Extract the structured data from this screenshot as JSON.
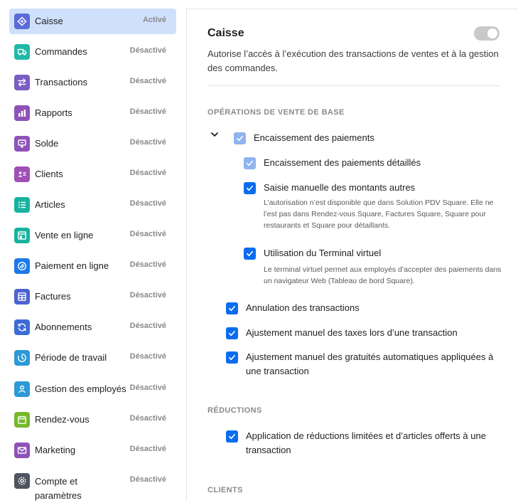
{
  "sidebar": {
    "items": [
      {
        "label": "Caisse",
        "status": "Activé",
        "icon": "register-icon",
        "color": "#5b6bd8"
      },
      {
        "label": "Commandes",
        "status": "Désactivé",
        "icon": "truck-icon",
        "color": "#20b8a6"
      },
      {
        "label": "Transactions",
        "status": "Désactivé",
        "icon": "swap-arrows-icon",
        "color": "#7b5cc4"
      },
      {
        "label": "Rapports",
        "status": "Désactivé",
        "icon": "bar-chart-icon",
        "color": "#8e52b8"
      },
      {
        "label": "Solde",
        "status": "Désactivé",
        "icon": "balance-icon",
        "color": "#8e52b8"
      },
      {
        "label": "Clients",
        "status": "Désactivé",
        "icon": "customer-card-icon",
        "color": "#a04fb6"
      },
      {
        "label": "Articles",
        "status": "Désactivé",
        "icon": "list-icon",
        "color": "#18b3a0"
      },
      {
        "label": "Vente en ligne",
        "status": "Désactivé",
        "icon": "storefront-icon",
        "color": "#18b3a0"
      },
      {
        "label": "Paiement en ligne",
        "status": "Désactivé",
        "icon": "link-icon",
        "color": "#1d7be8"
      },
      {
        "label": "Factures",
        "status": "Désactivé",
        "icon": "invoice-icon",
        "color": "#4b62d0"
      },
      {
        "label": "Abonnements",
        "status": "Désactivé",
        "icon": "refresh-icon",
        "color": "#3d6bd6"
      },
      {
        "label": "Période de travail",
        "status": "Désactivé",
        "icon": "clock-icon",
        "color": "#2b9ad6"
      },
      {
        "label": "Gestion des employés",
        "status": "Désactivé",
        "icon": "employee-icon",
        "color": "#2b9ad6"
      },
      {
        "label": "Rendez-vous",
        "status": "Désactivé",
        "icon": "calendar-icon",
        "color": "#76b82a"
      },
      {
        "label": "Marketing",
        "status": "Désactivé",
        "icon": "envelope-icon",
        "color": "#8e52b8"
      },
      {
        "label": "Compte et paramètres",
        "status": "Désactivé",
        "icon": "gear-icon",
        "color": "#4f5560"
      }
    ]
  },
  "main": {
    "title": "Caisse",
    "toggle_state": "off",
    "description": "Autorise l’accès à l’exécution des transactions de ventes et à la gestion des commandes.",
    "sections": {
      "base": "OPÉRATIONS DE VENTE DE BASE",
      "reductions": "RÉDUCTIONS",
      "clients": "CLIENTS"
    },
    "options": {
      "encaissement": "Encaissement des paiements",
      "encaissement_detail": "Encaissement des paiements détaillés",
      "saisie": "Saisie manuelle des montants autres",
      "saisie_note": "L’autorisation n’est disponible que dans Solution PDV Square. Elle ne l’est pas dans Rendez-vous Square, Factures Square, Square pour restaurants et Square pour détaillants.",
      "terminal": "Utilisation du Terminal virtuel",
      "terminal_note": "Le terminal virtuel permet aux employés d’accepter des paiements dans un navigateur Web (Tableau de bord Square).",
      "annulation": "Annulation des transactions",
      "taxes": "Ajustement manuel des taxes lors d’une transaction",
      "gratuites": "Ajustement manuel des gratuités automatiques appliquées à une transaction",
      "reductions_opt": "Application de réductions limitées et d’articles offerts à une transaction"
    }
  }
}
